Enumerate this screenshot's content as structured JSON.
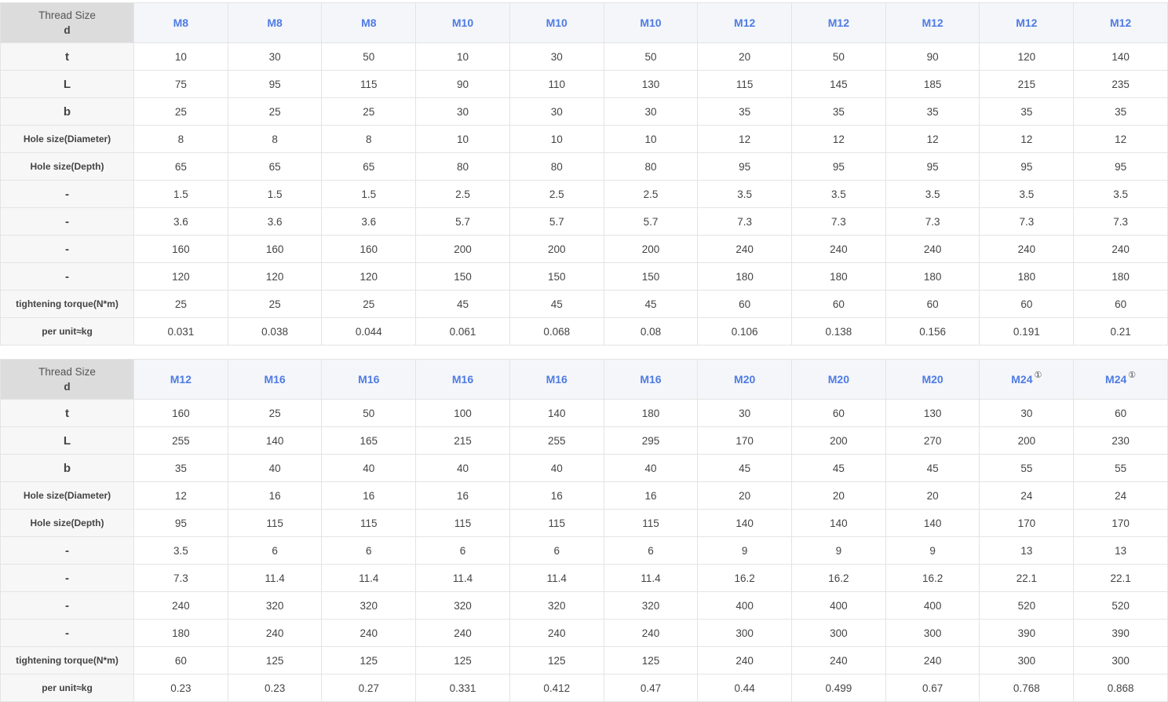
{
  "tables": [
    {
      "corner": {
        "line1": "Thread Size",
        "line2": "d"
      },
      "columns": [
        {
          "label": "M8",
          "note": ""
        },
        {
          "label": "M8",
          "note": ""
        },
        {
          "label": "M8",
          "note": ""
        },
        {
          "label": "M10",
          "note": ""
        },
        {
          "label": "M10",
          "note": ""
        },
        {
          "label": "M10",
          "note": ""
        },
        {
          "label": "M12",
          "note": ""
        },
        {
          "label": "M12",
          "note": ""
        },
        {
          "label": "M12",
          "note": ""
        },
        {
          "label": "M12",
          "note": ""
        },
        {
          "label": "M12",
          "note": ""
        }
      ],
      "rows": [
        {
          "label": "t",
          "big": true,
          "values": [
            "10",
            "30",
            "50",
            "10",
            "30",
            "50",
            "20",
            "50",
            "90",
            "120",
            "140"
          ]
        },
        {
          "label": "L",
          "big": true,
          "values": [
            "75",
            "95",
            "115",
            "90",
            "110",
            "130",
            "115",
            "145",
            "185",
            "215",
            "235"
          ]
        },
        {
          "label": "b",
          "big": true,
          "values": [
            "25",
            "25",
            "25",
            "30",
            "30",
            "30",
            "35",
            "35",
            "35",
            "35",
            "35"
          ]
        },
        {
          "label": "Hole size(Diameter)",
          "big": false,
          "values": [
            "8",
            "8",
            "8",
            "10",
            "10",
            "10",
            "12",
            "12",
            "12",
            "12",
            "12"
          ]
        },
        {
          "label": "Hole size(Depth)",
          "big": false,
          "values": [
            "65",
            "65",
            "65",
            "80",
            "80",
            "80",
            "95",
            "95",
            "95",
            "95",
            "95"
          ]
        },
        {
          "label": "-",
          "big": true,
          "values": [
            "1.5",
            "1.5",
            "1.5",
            "2.5",
            "2.5",
            "2.5",
            "3.5",
            "3.5",
            "3.5",
            "3.5",
            "3.5"
          ]
        },
        {
          "label": "-",
          "big": true,
          "values": [
            "3.6",
            "3.6",
            "3.6",
            "5.7",
            "5.7",
            "5.7",
            "7.3",
            "7.3",
            "7.3",
            "7.3",
            "7.3"
          ]
        },
        {
          "label": "-",
          "big": true,
          "values": [
            "160",
            "160",
            "160",
            "200",
            "200",
            "200",
            "240",
            "240",
            "240",
            "240",
            "240"
          ]
        },
        {
          "label": "-",
          "big": true,
          "values": [
            "120",
            "120",
            "120",
            "150",
            "150",
            "150",
            "180",
            "180",
            "180",
            "180",
            "180"
          ]
        },
        {
          "label": "tightening torque(N*m)",
          "big": false,
          "values": [
            "25",
            "25",
            "25",
            "45",
            "45",
            "45",
            "60",
            "60",
            "60",
            "60",
            "60"
          ]
        },
        {
          "label": "per unit≈kg",
          "big": false,
          "values": [
            "0.031",
            "0.038",
            "0.044",
            "0.061",
            "0.068",
            "0.08",
            "0.106",
            "0.138",
            "0.156",
            "0.191",
            "0.21"
          ]
        }
      ]
    },
    {
      "corner": {
        "line1": "Thread Size",
        "line2": "d"
      },
      "columns": [
        {
          "label": "M12",
          "note": ""
        },
        {
          "label": "M16",
          "note": ""
        },
        {
          "label": "M16",
          "note": ""
        },
        {
          "label": "M16",
          "note": ""
        },
        {
          "label": "M16",
          "note": ""
        },
        {
          "label": "M16",
          "note": ""
        },
        {
          "label": "M20",
          "note": ""
        },
        {
          "label": "M20",
          "note": ""
        },
        {
          "label": "M20",
          "note": ""
        },
        {
          "label": "M24",
          "note": "①"
        },
        {
          "label": "M24",
          "note": "①"
        }
      ],
      "rows": [
        {
          "label": "t",
          "big": true,
          "values": [
            "160",
            "25",
            "50",
            "100",
            "140",
            "180",
            "30",
            "60",
            "130",
            "30",
            "60"
          ]
        },
        {
          "label": "L",
          "big": true,
          "values": [
            "255",
            "140",
            "165",
            "215",
            "255",
            "295",
            "170",
            "200",
            "270",
            "200",
            "230"
          ]
        },
        {
          "label": "b",
          "big": true,
          "values": [
            "35",
            "40",
            "40",
            "40",
            "40",
            "40",
            "45",
            "45",
            "45",
            "55",
            "55"
          ]
        },
        {
          "label": "Hole size(Diameter)",
          "big": false,
          "values": [
            "12",
            "16",
            "16",
            "16",
            "16",
            "16",
            "20",
            "20",
            "20",
            "24",
            "24"
          ]
        },
        {
          "label": "Hole size(Depth)",
          "big": false,
          "values": [
            "95",
            "115",
            "115",
            "115",
            "115",
            "115",
            "140",
            "140",
            "140",
            "170",
            "170"
          ]
        },
        {
          "label": "-",
          "big": true,
          "values": [
            "3.5",
            "6",
            "6",
            "6",
            "6",
            "6",
            "9",
            "9",
            "9",
            "13",
            "13"
          ]
        },
        {
          "label": "-",
          "big": true,
          "values": [
            "7.3",
            "11.4",
            "11.4",
            "11.4",
            "11.4",
            "11.4",
            "16.2",
            "16.2",
            "16.2",
            "22.1",
            "22.1"
          ]
        },
        {
          "label": "-",
          "big": true,
          "values": [
            "240",
            "320",
            "320",
            "320",
            "320",
            "320",
            "400",
            "400",
            "400",
            "520",
            "520"
          ]
        },
        {
          "label": "-",
          "big": true,
          "values": [
            "180",
            "240",
            "240",
            "240",
            "240",
            "240",
            "300",
            "300",
            "300",
            "390",
            "390"
          ]
        },
        {
          "label": "tightening torque(N*m)",
          "big": false,
          "values": [
            "60",
            "125",
            "125",
            "125",
            "125",
            "125",
            "240",
            "240",
            "240",
            "300",
            "300"
          ]
        },
        {
          "label": "per unit≈kg",
          "big": false,
          "values": [
            "0.23",
            "0.23",
            "0.27",
            "0.331",
            "0.412",
            "0.47",
            "0.44",
            "0.499",
            "0.67",
            "0.768",
            "0.868"
          ]
        }
      ]
    }
  ]
}
